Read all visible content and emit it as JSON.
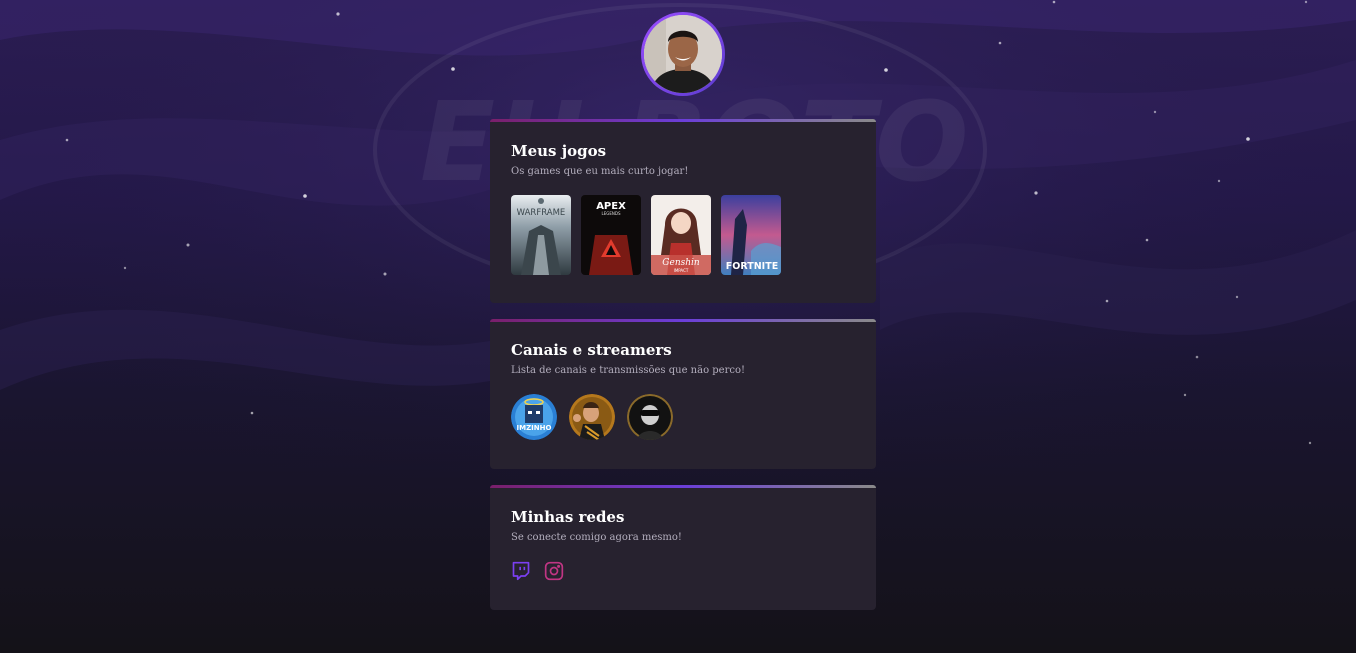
{
  "profile": {
    "avatar_icon": "profile-photo"
  },
  "games_card": {
    "title": "Meus jogos",
    "subtitle": "Os games que eu mais curto jogar!",
    "games": [
      {
        "label": "WARFRAME"
      },
      {
        "label": "APEX",
        "sublabel": "LEGENDS"
      },
      {
        "label": "Genshin",
        "sublabel": "IMPACT"
      },
      {
        "label": "FORTNITE"
      }
    ]
  },
  "streamers_card": {
    "title": "Canais e streamers",
    "subtitle": "Lista de canais e transmissões que não perco!",
    "streamers": [
      {
        "label": "IMZINHO"
      },
      {
        "label": ""
      },
      {
        "label": ""
      }
    ]
  },
  "socials_card": {
    "title": "Minhas redes",
    "subtitle": "Se conecte comigo agora mesmo!",
    "icons": [
      "twitch-icon",
      "instagram-icon"
    ]
  },
  "colors": {
    "accent_purple": "#7b3ff2",
    "instagram": "#c13584",
    "card_bg": "#27222f"
  }
}
